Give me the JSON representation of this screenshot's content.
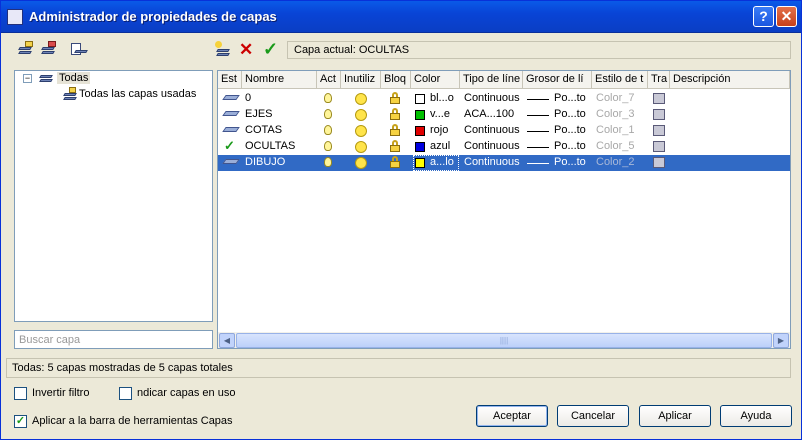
{
  "window": {
    "title": "Administrador de propiedades de capas",
    "help_label": "?",
    "close_label": "✕"
  },
  "toolbar_left": {
    "icons": [
      "new-property-filter-icon",
      "new-group-filter-icon",
      "layer-states-manager-icon"
    ]
  },
  "toolbar_right": {
    "icons": [
      "new-layer-icon",
      "delete-layer-icon",
      "set-current-icon"
    ]
  },
  "current_layer": "Capa actual: OCULTAS",
  "tree": {
    "root": {
      "label": "Todas",
      "expander": "⊟"
    },
    "child": {
      "label": "Todas las capas usadas"
    }
  },
  "search_placeholder": "Buscar capa",
  "columns": [
    "Est",
    "Nombre",
    "Act",
    "Inutiliz",
    "Bloq",
    "Color",
    "Tipo de líne",
    "Grosor de lí",
    "Estilo de t",
    "Tra",
    "Descripción"
  ],
  "layers": [
    {
      "status": "layer",
      "name": "0",
      "color_name": "bl...o",
      "color_hex": "#ffffff",
      "linetype": "Continuous",
      "lineweight": "Po...to",
      "plot_style": "Color_7",
      "selected": false
    },
    {
      "status": "layer",
      "name": "EJES",
      "color_name": "v...e",
      "color_hex": "#00c000",
      "linetype": "ACA...100",
      "lineweight": "Po...to",
      "plot_style": "Color_3",
      "selected": false
    },
    {
      "status": "layer",
      "name": "COTAS",
      "color_name": "rojo",
      "color_hex": "#e00000",
      "linetype": "Continuous",
      "lineweight": "Po...to",
      "plot_style": "Color_1",
      "selected": false
    },
    {
      "status": "current",
      "name": "OCULTAS",
      "color_name": "azul",
      "color_hex": "#0000e0",
      "linetype": "Continuous",
      "lineweight": "Po...to",
      "plot_style": "Color_5",
      "selected": false
    },
    {
      "status": "layer",
      "name": "DIBUJO",
      "color_name": "a...lo",
      "color_hex": "#ffff00",
      "linetype": "Continuous",
      "lineweight": "Po...to",
      "plot_style": "Color_2",
      "selected": true
    }
  ],
  "status_bar": "Todas: 5 capas mostradas de 5 capas totales",
  "options": {
    "invert_filter": {
      "label": "Invertir filtro",
      "checked": false
    },
    "indicate_used": {
      "label": "ndicar capas en uso",
      "checked": false
    },
    "apply_toolbar": {
      "label": "Aplicar a la barra de herramientas Capas",
      "checked": true
    }
  },
  "buttons": {
    "ok": "Aceptar",
    "cancel": "Cancelar",
    "apply": "Aplicar",
    "help": "Ayuda"
  },
  "checkmark": "✓",
  "scroll": {
    "left": "◀",
    "right": "▶",
    "grip": "||||"
  }
}
